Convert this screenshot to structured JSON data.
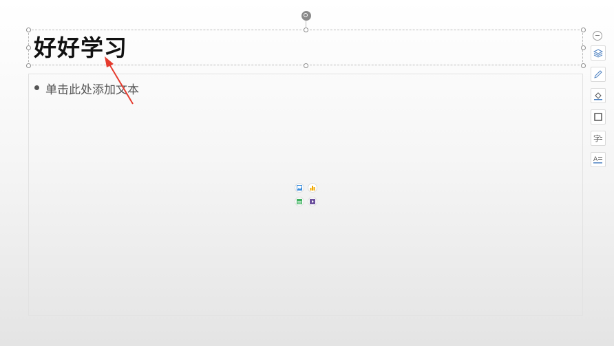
{
  "slide": {
    "title": "好好学习",
    "content_placeholder": "单击此处添加文本"
  },
  "insert_buttons": [
    {
      "name": "insert-picture",
      "icon": "picture-icon",
      "color": "#3d8ddb"
    },
    {
      "name": "insert-chart",
      "icon": "chart-icon",
      "color": "#f2a900"
    },
    {
      "name": "insert-table",
      "icon": "table-icon",
      "color": "#3fb15f"
    },
    {
      "name": "insert-video",
      "icon": "video-icon",
      "color": "#6b4f9c"
    }
  ],
  "side_toolbar": {
    "items": [
      {
        "icon": "layers-icon"
      },
      {
        "icon": "pen-icon"
      },
      {
        "icon": "fill-icon"
      },
      {
        "icon": "outline-icon"
      },
      {
        "icon": "font-icon",
        "glyph": "字"
      },
      {
        "icon": "text-format-icon",
        "glyph": "A"
      }
    ]
  },
  "annotation": {
    "color": "#e53b2e"
  }
}
